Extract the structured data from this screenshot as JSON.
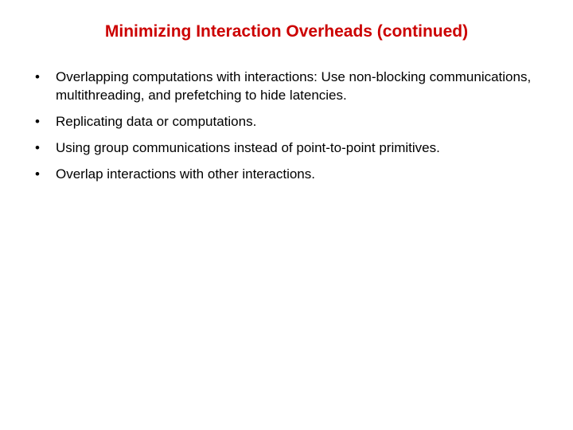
{
  "slide": {
    "title": "Minimizing Interaction Overheads (continued)",
    "bullets": [
      "Overlapping computations with interactions: Use non-blocking communications, multithreading, and prefetching to hide latencies.",
      "Replicating data or computations.",
      "Using group communications instead of point-to-point primitives.",
      "Overlap interactions with other interactions."
    ]
  }
}
